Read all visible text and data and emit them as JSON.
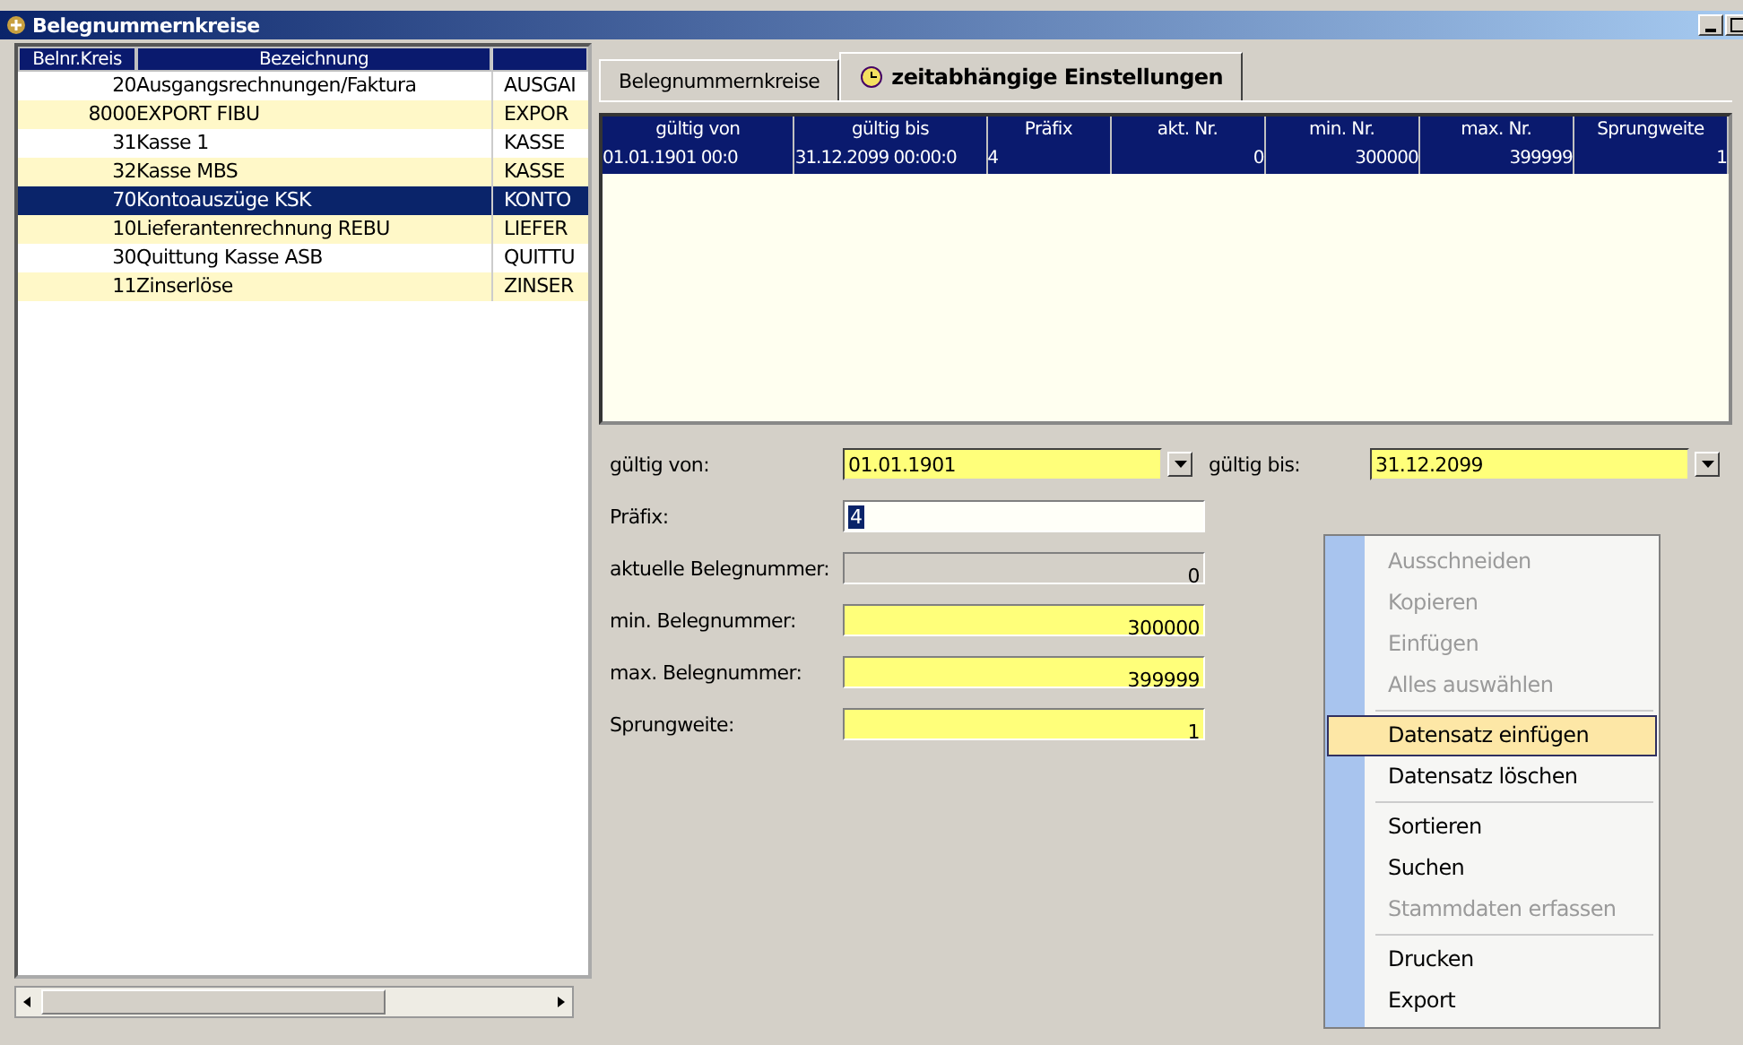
{
  "window": {
    "title": "Belegnummernkreise"
  },
  "list": {
    "columns": [
      "Belnr.Kreis",
      "Bezeichnung"
    ],
    "rows": [
      {
        "number": "20",
        "name": "Ausgangsrechnungen/Faktura",
        "code": "AUSGAI",
        "selected": false
      },
      {
        "number": "8000",
        "name": "EXPORT FIBU",
        "code": "EXPOR",
        "selected": false
      },
      {
        "number": "31",
        "name": "Kasse 1",
        "code": "KASSE",
        "selected": false
      },
      {
        "number": "32",
        "name": "Kasse MBS",
        "code": "KASSE",
        "selected": false
      },
      {
        "number": "70",
        "name": "Kontoauszüge KSK",
        "code": "KONTO",
        "selected": true
      },
      {
        "number": "10",
        "name": "Lieferantenrechnung REBU",
        "code": "LIEFER",
        "selected": false
      },
      {
        "number": "30",
        "name": "Quittung Kasse ASB",
        "code": "QUITTU",
        "selected": false
      },
      {
        "number": "11",
        "name": "Zinserlöse",
        "code": "ZINSER",
        "selected": false
      }
    ]
  },
  "tabs": [
    {
      "label": "Belegnummernkreise",
      "selected": false
    },
    {
      "label": "zeitabhängige Einstellungen",
      "selected": true
    }
  ],
  "grid": {
    "columns": [
      "gültig von",
      "gültig bis",
      "Präfix",
      "akt. Nr.",
      "min. Nr.",
      "max. Nr.",
      "Sprungweite"
    ],
    "rows": [
      {
        "cells": [
          "01.01.1901 00:0",
          "31.12.2099 00:00:0",
          "4",
          "0",
          "300000",
          "399999",
          "1"
        ],
        "selected": true
      }
    ]
  },
  "form": [
    {
      "label": "gültig von:",
      "value": "01.01.1901",
      "kind": "combo",
      "required": true,
      "disabled": false,
      "second_label": "gültig bis:",
      "second_value": "31.12.2099"
    },
    {
      "label": "Präfix:",
      "value": "4",
      "kind": "text",
      "required": false,
      "disabled": false
    },
    {
      "label": "aktuelle Belegnummer:",
      "value": "0",
      "kind": "number",
      "required": false,
      "disabled": true
    },
    {
      "label": "min. Belegnummer:",
      "value": "300000",
      "kind": "number",
      "required": true,
      "disabled": false
    },
    {
      "label": "max. Belegnummer:",
      "value": "399999",
      "kind": "number",
      "required": true,
      "disabled": false
    },
    {
      "label": "Sprungweite:",
      "value": "1",
      "kind": "number",
      "required": true,
      "disabled": false
    }
  ],
  "context_menu": [
    [
      {
        "label": "Ausschneiden",
        "disabled": true,
        "selected": false
      },
      {
        "label": "Kopieren",
        "disabled": true,
        "selected": false
      },
      {
        "label": "Einfügen",
        "disabled": true,
        "selected": false
      },
      {
        "label": "Alles auswählen",
        "disabled": true,
        "selected": false
      }
    ],
    [
      {
        "label": "Datensatz einfügen",
        "disabled": false,
        "selected": true
      },
      {
        "label": "Datensatz löschen",
        "disabled": false,
        "selected": false
      }
    ],
    [
      {
        "label": "Sortieren",
        "disabled": false,
        "selected": false
      },
      {
        "label": "Suchen",
        "disabled": false,
        "selected": false
      },
      {
        "label": "Stammdaten erfassen",
        "disabled": true,
        "selected": false
      }
    ],
    [
      {
        "label": "Drucken",
        "disabled": false,
        "selected": false
      },
      {
        "label": "Export",
        "disabled": false,
        "selected": false
      }
    ]
  ]
}
